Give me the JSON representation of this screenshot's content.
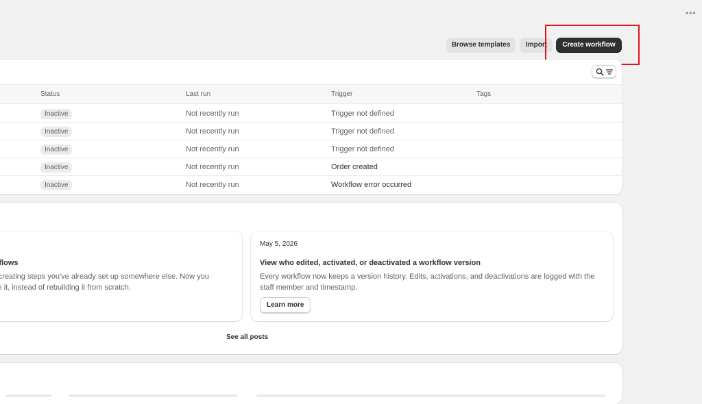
{
  "header": {
    "more_label": "•••",
    "browse_templates": "Browse templates",
    "import": "Import",
    "create_workflow": "Create workflow"
  },
  "table": {
    "columns": [
      "Status",
      "Last run",
      "Trigger",
      "Tags"
    ],
    "rows": [
      {
        "status": "Inactive",
        "last_run": "Not recently run",
        "trigger": "Trigger not defined"
      },
      {
        "status": "Inactive",
        "last_run": "Not recently run",
        "trigger": "Trigger not defined"
      },
      {
        "status": "Inactive",
        "last_run": "Not recently run",
        "trigger": "Trigger not defined"
      },
      {
        "status": "Inactive",
        "last_run": "Not recently run",
        "trigger": "Order created"
      },
      {
        "status": "Inactive",
        "last_run": "Not recently run",
        "trigger": "Workflow error occurred"
      }
    ]
  },
  "news": {
    "posts": [
      {
        "title": "rkflows",
        "body": "recreating steps you've already set up somewhere else. Now you ste it, instead of rebuilding it from scratch."
      },
      {
        "date": "May 5, 2026",
        "title": "View who edited, activated, or deactivated a workflow version",
        "body": "Every workflow now keeps a version history. Edits, activations, and deactivations are logged with the staff member and timestamp.",
        "button": "Learn more"
      }
    ],
    "see_all": "See all posts"
  },
  "icons": {
    "search": "search-icon",
    "filter": "filter-lines-icon",
    "more": "more-horizontal-icon"
  },
  "colors": {
    "primary_button": "#303030",
    "highlight": "#e0141e",
    "background": "#f1f1f1"
  }
}
